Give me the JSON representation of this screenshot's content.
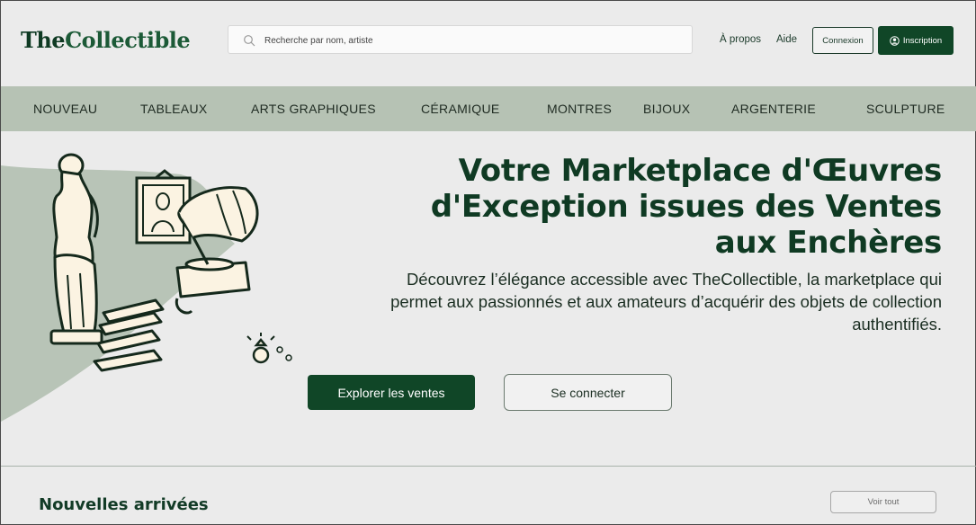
{
  "header": {
    "logo_part1": "The",
    "logo_part2": "Collectible",
    "search_placeholder": "Recherche par nom, artiste",
    "links": [
      "À propos",
      "Aide"
    ],
    "login_label": "Connexion",
    "signup_label": "Inscription"
  },
  "nav": {
    "items": [
      "NOUVEAU",
      "TABLEAUX",
      "ARTS GRAPHIQUES",
      "CÉRAMIQUE",
      "MONTRES",
      "BIJOUX",
      "ARGENTERIE",
      "SCULPTURE"
    ]
  },
  "hero": {
    "title": "Votre Marketplace d'Œuvres d'Exception issues des Ventes aux Enchères",
    "subtitle": "Découvrez l’élégance accessible avec TheCollectible, la marketplace qui permet aux passionnés et aux amateurs d’acquérir des objets de collection authentifiés.",
    "primary_button": "Explorer les ventes",
    "secondary_button": "Se connecter"
  },
  "new_arrivals": {
    "title": "Nouvelles arrivées",
    "see_all": "Voir tout"
  },
  "colors": {
    "brand_dark": "#104627",
    "nav_bg": "#b6c2b4",
    "page_bg": "#ebebeb"
  },
  "icons": [
    "search-icon",
    "user-circle-icon"
  ]
}
